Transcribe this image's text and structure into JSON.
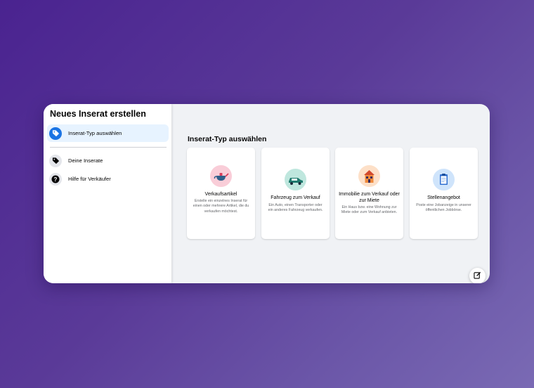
{
  "sidebar": {
    "title": "Neues Inserat erstellen",
    "items": [
      {
        "label": "Inserat-Typ auswählen",
        "icon": "tag-icon",
        "active": true
      },
      {
        "label": "Deine Inserate",
        "icon": "tags-icon",
        "active": false
      },
      {
        "label": "Hilfe für Verkäufer",
        "icon": "help-icon",
        "active": false
      }
    ]
  },
  "main": {
    "title": "Inserat-Typ auswählen",
    "cards": [
      {
        "title": "Verkaufsartikel",
        "description": "Erstelle ein einzelnes Inserat für einen oder mehrere Artikel, die du verkaufen möchtest.",
        "icon": "teapot-icon",
        "icon_bg": "#f9cdd8"
      },
      {
        "title": "Fahrzeug zum Verkauf",
        "description": "Ein Auto, einen Transporter oder ein anderes Fahrzeug verkaufen.",
        "icon": "car-icon",
        "icon_bg": "#bfe7de"
      },
      {
        "title": "Immobilie zum Verkauf oder zur Miete",
        "description": "Ein Haus bzw. eine Wohnung zur Miete oder zum Verkauf anbieten.",
        "icon": "house-icon",
        "icon_bg": "#fde0c8"
      },
      {
        "title": "Stellenangebot",
        "description": "Poste eine Jobanzeige in unserer öffentlichen Jobbörse.",
        "icon": "clipboard-icon",
        "icon_bg": "#cfe4fb"
      }
    ]
  },
  "colors": {
    "accent": "#1b74e4",
    "active_bg": "#e7f3ff"
  }
}
